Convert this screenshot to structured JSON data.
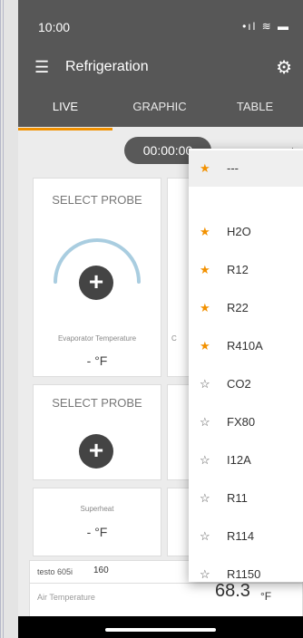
{
  "status": {
    "time": "10:00",
    "icons": "•ıl ≋ ▬"
  },
  "appbar": {
    "title": "Refrigeration"
  },
  "tabs": [
    {
      "label": "LIVE",
      "active": true
    },
    {
      "label": "GRAPHIC",
      "active": false
    },
    {
      "label": "TABLE",
      "active": false
    }
  ],
  "controls": {
    "timer": "00:00:00",
    "refrigerant": "---",
    "arrow": "▲"
  },
  "cards": [
    {
      "title": "SELECT PROBE",
      "label": "Evaporator Temperature",
      "value": "- °F"
    },
    {
      "title": "SELECT PROBE"
    },
    {
      "label": "Superheat",
      "value": "- °F"
    }
  ],
  "partial": {
    "label_fragment": "C"
  },
  "dropdown": {
    "items": [
      {
        "label": "---",
        "favorite": true,
        "selected": true
      },
      {
        "label": "H2O",
        "favorite": true
      },
      {
        "label": "R12",
        "favorite": true
      },
      {
        "label": "R22",
        "favorite": true
      },
      {
        "label": "R410A",
        "favorite": true
      },
      {
        "label": "CO2",
        "favorite": false
      },
      {
        "label": "FX80",
        "favorite": false
      },
      {
        "label": "I12A",
        "favorite": false
      },
      {
        "label": "R11",
        "favorite": false
      },
      {
        "label": "R114",
        "favorite": false
      },
      {
        "label": "R1150",
        "favorite": false
      }
    ]
  },
  "bottom": {
    "probe": "testo 605i",
    "probe_number": "160",
    "label": "Air Temperature",
    "value": "68.3",
    "unit": "°F"
  },
  "colors": {
    "accent": "#f29100",
    "bar": "#575757",
    "gauge": "#a9cde0"
  }
}
